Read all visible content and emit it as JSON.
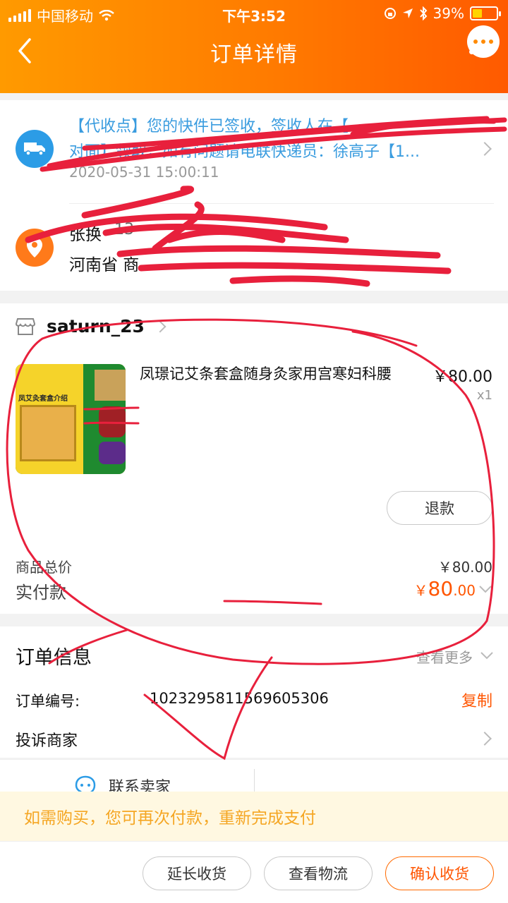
{
  "status_bar": {
    "carrier": "中国移动",
    "time": "下午3:52",
    "battery": "39%"
  },
  "nav": {
    "title": "订单详情"
  },
  "logistics": {
    "line1": "【代收点】您的快件已签收，签收人在【",
    "line2": "对面】领取，如有问题请电联快递员：徐高子【1...",
    "time": "2020-05-31 15:00:11"
  },
  "address": {
    "name": "张换",
    "phone": "13",
    "line": "河南省 商"
  },
  "shop": {
    "name": "saturn_23"
  },
  "product": {
    "title": "凤璟记艾条套盒随身灸家用宫寒妇科腰",
    "price": "￥80.00",
    "qty": "x1",
    "thumb_text": "凤艾灸套盒介绍",
    "refund_label": "退款"
  },
  "summary": {
    "total_label": "商品总价",
    "total_value": "￥80.00",
    "paid_label": "实付款",
    "paid_currency": "￥",
    "paid_int": "80",
    "paid_dec": ".00"
  },
  "order_info": {
    "title": "订单信息",
    "see_more": "查看更多",
    "number_label": "订单编号:",
    "number_value": "1023295811569605306",
    "copy_label": "复制",
    "complain_label": "投诉商家"
  },
  "contact": {
    "label": "联系卖家"
  },
  "notice": {
    "text": "如需购买，您可再次付款，重新完成支付"
  },
  "actions": {
    "extend": "延长收货",
    "logistics": "查看物流",
    "confirm": "确认收货"
  },
  "colors": {
    "brand": "#ff7a00",
    "price": "#ff5500",
    "link": "#3a9cdf",
    "annotation": "#e8203c"
  },
  "icons": [
    "back-arrow-icon",
    "more-icon",
    "truck-icon",
    "location-pin-icon",
    "shop-icon",
    "chevron-right-icon",
    "chevron-down-icon",
    "chat-icon"
  ]
}
